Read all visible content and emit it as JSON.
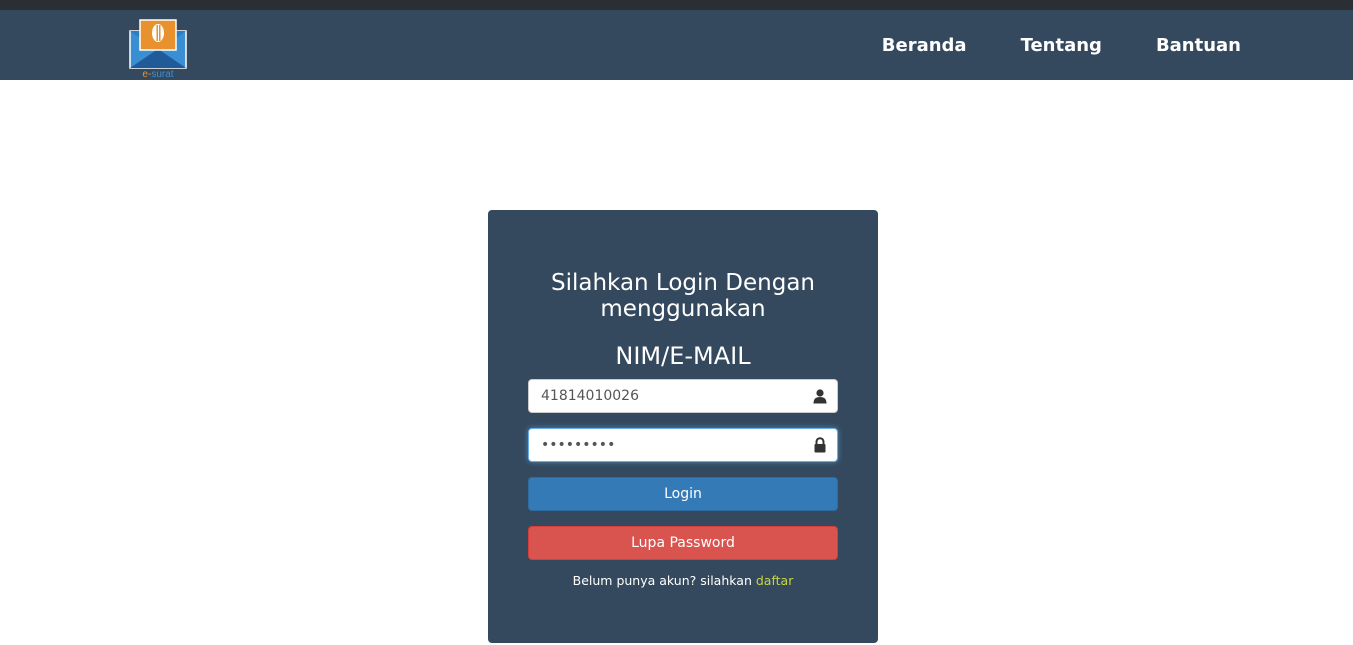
{
  "logo": {
    "text_e": "e-",
    "text_surat": "surat",
    "colors": {
      "orange": "#e8912d",
      "blue": "#3a8fd3",
      "dark_blue": "#1f5b99"
    }
  },
  "nav": {
    "items": [
      {
        "label": "Beranda"
      },
      {
        "label": "Tentang"
      },
      {
        "label": "Bantuan"
      }
    ]
  },
  "login": {
    "title": "Silahkan Login Dengan menggunakan",
    "subtitle": "NIM/E-MAIL",
    "username_value": "41814010026",
    "username_icon": "user-icon",
    "password_value": "123456789",
    "password_icon": "lock-icon",
    "login_button": "Login",
    "forgot_button": "Lupa Password",
    "register_prompt": "Belum punya akun? silahkan",
    "register_link": "daftar"
  },
  "colors": {
    "navbar": "#34495e",
    "card": "#34495e",
    "login_button": "#337ab7",
    "forgot_button": "#d9534f",
    "register_link": "#c8d644"
  }
}
